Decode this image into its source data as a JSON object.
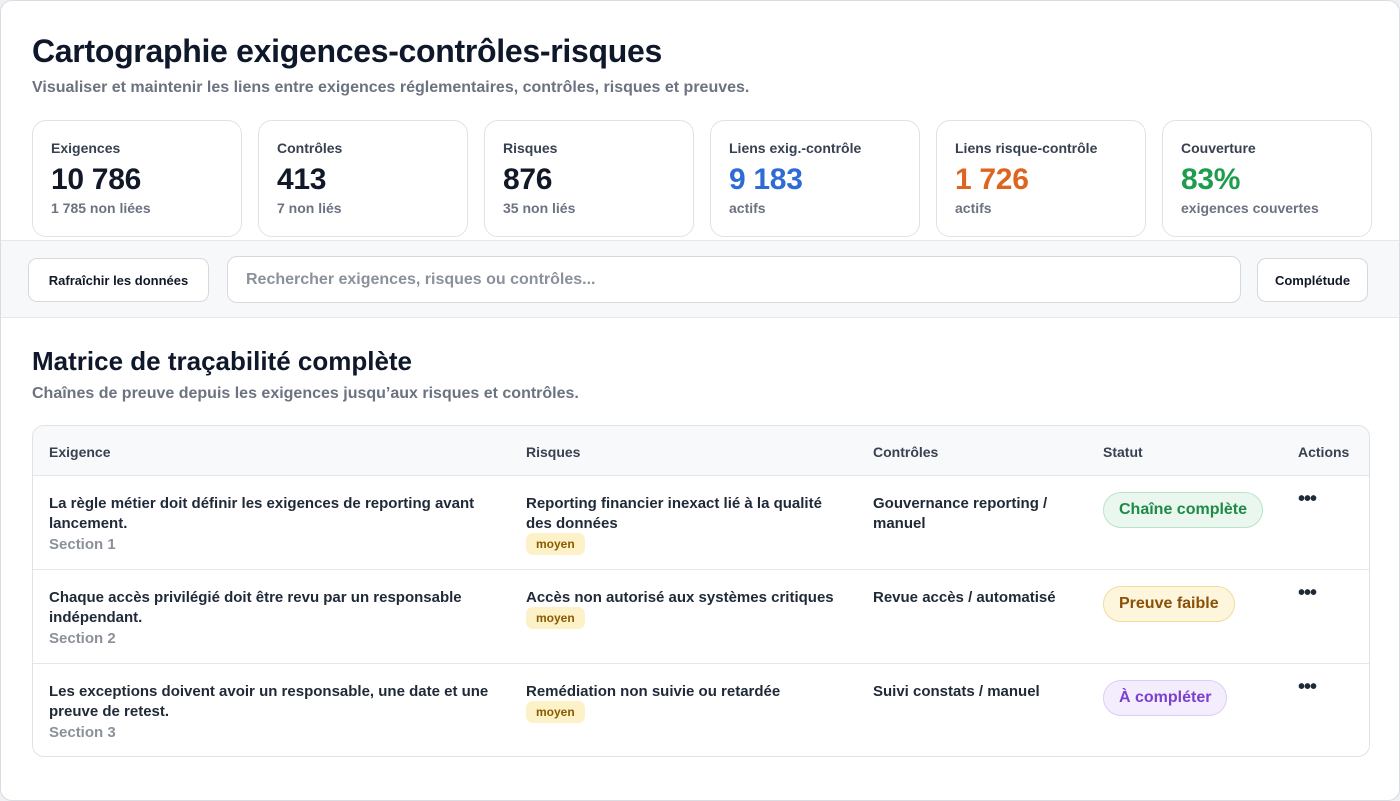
{
  "header": {
    "title": "Cartographie exigences-contrôles-risques",
    "subtitle": "Visualiser et maintenir les liens entre exigences réglementaires, contrôles, risques et preuves."
  },
  "stats": [
    {
      "label": "Exigences",
      "value": "10 786",
      "sub": "1 785 non liées",
      "color": "#111827"
    },
    {
      "label": "Contrôles",
      "value": "413",
      "sub": "7 non liés",
      "color": "#111827"
    },
    {
      "label": "Risques",
      "value": "876",
      "sub": "35 non liés",
      "color": "#111827"
    },
    {
      "label": "Liens exig.-contrôle",
      "value": "9 183",
      "sub": "actifs",
      "color": "#2f6bd6"
    },
    {
      "label": "Liens risque-contrôle",
      "value": "1 726",
      "sub": "actifs",
      "color": "#dd6520"
    },
    {
      "label": "Couverture",
      "value": "83%",
      "sub": "exigences couvertes",
      "color": "#1f9d4d"
    }
  ],
  "toolbar": {
    "refresh_label": "Rafraîchir les données",
    "search_placeholder": "Rechercher exigences, risques ou contrôles...",
    "search_value": "",
    "completude_label": "Complétude"
  },
  "matrix": {
    "title": "Matrice de traçabilité complète",
    "subtitle": "Chaînes de preuve depuis les exigences jusqu’aux risques et contrôles.",
    "columns": [
      "Exigence",
      "Risques",
      "Contrôles",
      "Statut",
      "Actions"
    ],
    "rows": [
      {
        "requirement": "La règle métier doit définir les exigences de reporting avant lancement.",
        "section": "Section 1",
        "risk": "Reporting financier inexact lié à la qualité des données",
        "severity": "moyen",
        "control": "Gouvernance reporting / manuel",
        "status": "Chaîne complète",
        "status_color": "#1e8a46",
        "actions_icon": "more-horizontal-icon"
      },
      {
        "requirement": "Chaque accès privilégié doit être revu par un responsable indépendant.",
        "section": "Section 2",
        "risk": "Accès non autorisé aux systèmes critiques",
        "severity": "moyen",
        "control": "Revue accès / automatisé",
        "status": "Preuve faible",
        "status_color": "#8a5006",
        "actions_icon": "more-horizontal-icon"
      },
      {
        "requirement": "Les exceptions doivent avoir un responsable, une date et une preuve de retest.",
        "section": "Section 3",
        "risk": "Remédiation non suivie ou retardée",
        "severity": "moyen",
        "control": "Suivi constats / manuel",
        "status": "À compléter",
        "status_color": "#7c3fd1",
        "actions_icon": "more-horizontal-icon"
      }
    ]
  }
}
